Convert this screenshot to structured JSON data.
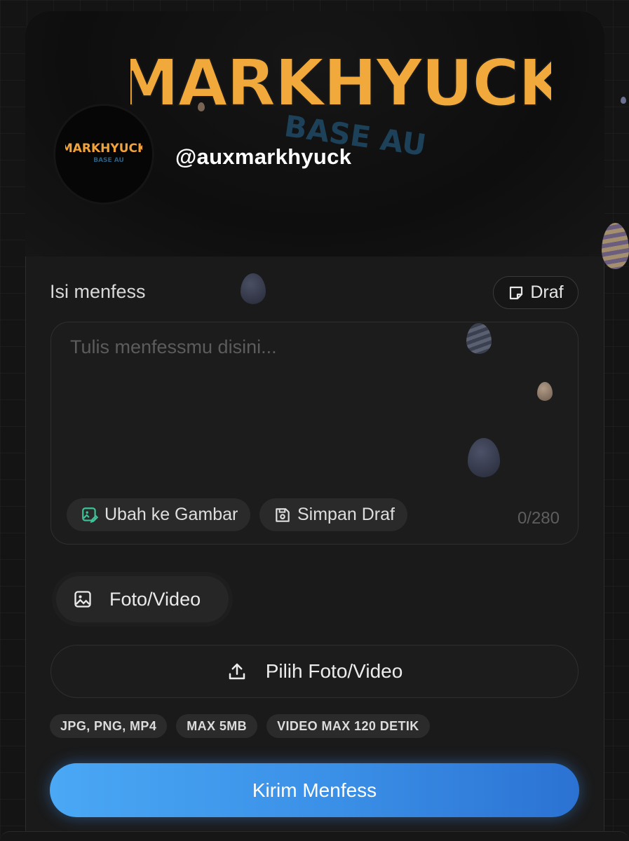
{
  "profile": {
    "banner_logo_text": "MARKHYUCK",
    "banner_logo_sub": "BASE AU",
    "avatar_logo_text": "MARKHYUCK",
    "avatar_logo_sub": "BASE AU",
    "username": "@auxmarkhyuck"
  },
  "form": {
    "label": "Isi menfess",
    "draft_button_label": "Draf",
    "textarea_placeholder": "Tulis menfessmu disini...",
    "char_counter": "0/280",
    "convert_image_label": "Ubah ke Gambar",
    "save_draft_label": "Simpan Draf"
  },
  "media": {
    "tab_label": "Foto/Video",
    "upload_label": "Pilih Foto/Video",
    "tags": [
      "JPG, PNG, MP4",
      "MAX 5MB",
      "VIDEO MAX 120 DETIK"
    ]
  },
  "submit_label": "Kirim Menfess",
  "colors": {
    "accent_start": "#4aa8f5",
    "accent_end": "#2b72d3",
    "background": "#141414",
    "card": "#1a1a1a"
  },
  "icons": {
    "draft": "sticky-note-icon",
    "convert": "image-edit-icon",
    "save": "floppy-disk-icon",
    "media": "image-icon",
    "upload": "upload-icon"
  }
}
